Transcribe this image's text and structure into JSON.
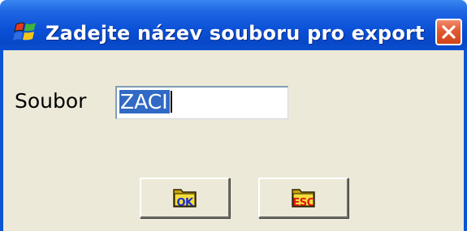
{
  "window": {
    "title": "Zadejte název souboru pro export",
    "close_icon": "close-icon",
    "app_icon": "windows-flag-icon"
  },
  "form": {
    "file_label": "Soubor",
    "file_value": "ZACI"
  },
  "buttons": {
    "ok_label": "OK",
    "ok_icon": "folder-icon",
    "ok_color": "#1a2bd6",
    "esc_label": "ESC",
    "esc_icon": "folder-icon",
    "esc_color": "#e01818"
  },
  "colors": {
    "titlebar": "#0a50d6",
    "client_bg": "#ece9d8",
    "selection": "#316ac5",
    "close_button": "#e25a33"
  }
}
